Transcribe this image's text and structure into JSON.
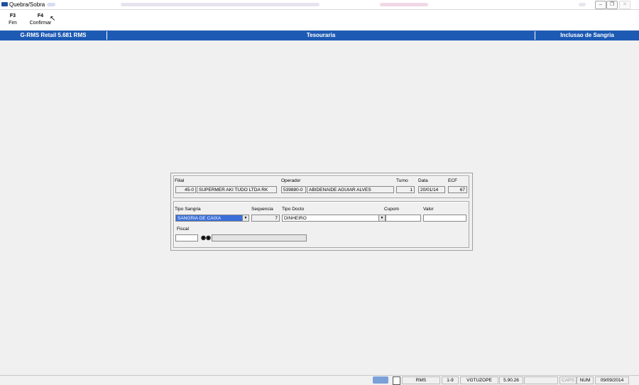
{
  "window": {
    "title": "Quebra/Sobra"
  },
  "toolbar": {
    "buttons": [
      {
        "key": "F3",
        "label": "Fim"
      },
      {
        "key": "F4",
        "label": "Confirmar"
      }
    ]
  },
  "header": {
    "app": "G-RMS Retail 5.681 RMS",
    "module": "Tesouraria",
    "screen": "Inclusao de Sangria"
  },
  "form": {
    "filial_label": "Filial",
    "filial_code": "45-0",
    "filial_name": "SUPERMER AKI TUDO LTDA RK",
    "operador_label": "Operador",
    "operador_code": "539880-0",
    "operador_name": "ABIDENAIDE AGUIAR ALVES",
    "turno_label": "Turno",
    "turno_value": "1",
    "data_label": "Data",
    "data_value": "20/01/14",
    "ecf_label": "ECF",
    "ecf_value": "67",
    "tipo_sangria_label": "Tipo Sangria",
    "tipo_sangria_value": "SANGRIA DE CAIXA",
    "sequencia_label": "Sequencia",
    "sequencia_value": "7",
    "tipo_docto_label": "Tipo Docto",
    "tipo_docto_value": "DINHEIRO",
    "cupom_label": "Cupom",
    "cupom_value": "",
    "valor_label": "Valor",
    "valor_value": "",
    "fiscal_label": "Fiscal",
    "fiscal_value": "",
    "fiscal_name": ""
  },
  "statusbar": {
    "system": "RMS",
    "range": "1-9",
    "user": "VGTUZOPE",
    "version": "5.90.26",
    "caps": "CAPS",
    "num": "NUM",
    "date": "09/09/2014"
  },
  "colors": {
    "header_bg": "#1d5ab4",
    "selection_bg": "#3a6fd8"
  },
  "icons": [
    "app-icon",
    "binoculars-icon",
    "dropdown-arrow-icon",
    "mouse-cursor-icon",
    "network-icon"
  ]
}
